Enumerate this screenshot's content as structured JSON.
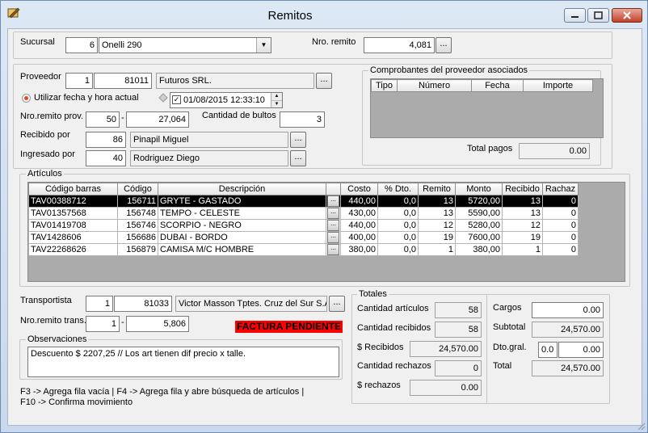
{
  "window": {
    "title": "Remitos"
  },
  "sucursal": {
    "label": "Sucursal",
    "code": "6",
    "name": "Onelli 290"
  },
  "nro_remito": {
    "label": "Nro. remito",
    "value": "4,081"
  },
  "proveedor": {
    "label": "Proveedor",
    "num": "1",
    "code": "81011",
    "name": "Futuros SRL."
  },
  "fecha": {
    "radio_label": "Utilizar fecha y hora actual",
    "value": "01/08/2015 12:33:10"
  },
  "remito_prov": {
    "label": "Nro.remito prov.",
    "part1": "50",
    "part2": "27,064"
  },
  "bultos": {
    "label": "Cantidad de bultos",
    "value": "3"
  },
  "recibido": {
    "label": "Recibido por",
    "code": "86",
    "name": "Pinapil Miguel"
  },
  "ingresado": {
    "label": "Ingresado por",
    "code": "40",
    "name": "Rodriguez Diego"
  },
  "comprobantes": {
    "title": "Comprobantes del proveedor asociados",
    "columns": [
      "Tipo",
      "Número",
      "Fecha",
      "Importe"
    ],
    "total_label": "Total pagos",
    "total_value": "0.00"
  },
  "articulos": {
    "title": "Artículos",
    "columns": [
      "Código barras",
      "Código",
      "Descripción",
      "",
      "Costo",
      "% Dto.",
      "Remito",
      "Monto",
      "Recibido",
      "Rachaz"
    ],
    "rows": [
      {
        "barras": "TAV00388712",
        "codigo": "156711",
        "desc": "GRYTE - GASTADO",
        "costo": "440,00",
        "dto": "0,0",
        "remito": "13",
        "monto": "5720,00",
        "recibido": "13",
        "rachaz": "0"
      },
      {
        "barras": "TAV01357568",
        "codigo": "156748",
        "desc": "TEMPO - CELESTE",
        "costo": "430,00",
        "dto": "0,0",
        "remito": "13",
        "monto": "5590,00",
        "recibido": "13",
        "rachaz": "0"
      },
      {
        "barras": "TAV01419708",
        "codigo": "156746",
        "desc": "SCORPIO - NEGRO",
        "costo": "440,00",
        "dto": "0,0",
        "remito": "12",
        "monto": "5280,00",
        "recibido": "12",
        "rachaz": "0"
      },
      {
        "barras": "TAV1428606",
        "codigo": "156686",
        "desc": "DUBAI - BORDO",
        "costo": "400,00",
        "dto": "0,0",
        "remito": "19",
        "monto": "7600,00",
        "recibido": "19",
        "rachaz": "0"
      },
      {
        "barras": "TAV22268626",
        "codigo": "156879",
        "desc": "CAMISA M/C HOMBRE",
        "costo": "380,00",
        "dto": "0,0",
        "remito": "1",
        "monto": "380,00",
        "recibido": "1",
        "rachaz": "0"
      }
    ]
  },
  "transportista": {
    "label": "Transportista",
    "num": "1",
    "code": "81033",
    "name": "Victor Masson Tptes. Cruz del Sur S.A."
  },
  "remito_trans": {
    "label": "Nro.remito trans.",
    "part1": "1",
    "part2": "5,806"
  },
  "badge": {
    "text": "FACTURA PENDIENTE",
    "color": "#ff0000"
  },
  "observaciones": {
    "title": "Observaciones",
    "text": "Descuento $ 2207,25 // Los art tienen dif precio x talle."
  },
  "totales": {
    "title": "Totales",
    "cant_articulos_label": "Cantidad artículos",
    "cant_articulos": "58",
    "cant_recibidos_label": "Cantidad recibidos",
    "cant_recibidos": "58",
    "recibidos_label": "$ Recibidos",
    "recibidos": "24,570.00",
    "cant_rechazos_label": "Cantidad rechazos",
    "cant_rechazos": "0",
    "rechazos_label": "$ rechazos",
    "rechazos": "0.00",
    "cargos_label": "Cargos",
    "cargos": "0.00",
    "subtotal_label": "Subtotal",
    "subtotal": "24,570.00",
    "dto_label": "Dto.gral.",
    "dto_pct": "0.0",
    "dto_val": "0.00",
    "total_label": "Total",
    "total": "24,570.00"
  },
  "hints": {
    "line1": "F3 -> Agrega fila vacía  |  F4 -> Agrega fila y abre búsqueda de artículos  |",
    "line2": "F10 -> Confirma movimiento"
  },
  "ellipsis": "..."
}
